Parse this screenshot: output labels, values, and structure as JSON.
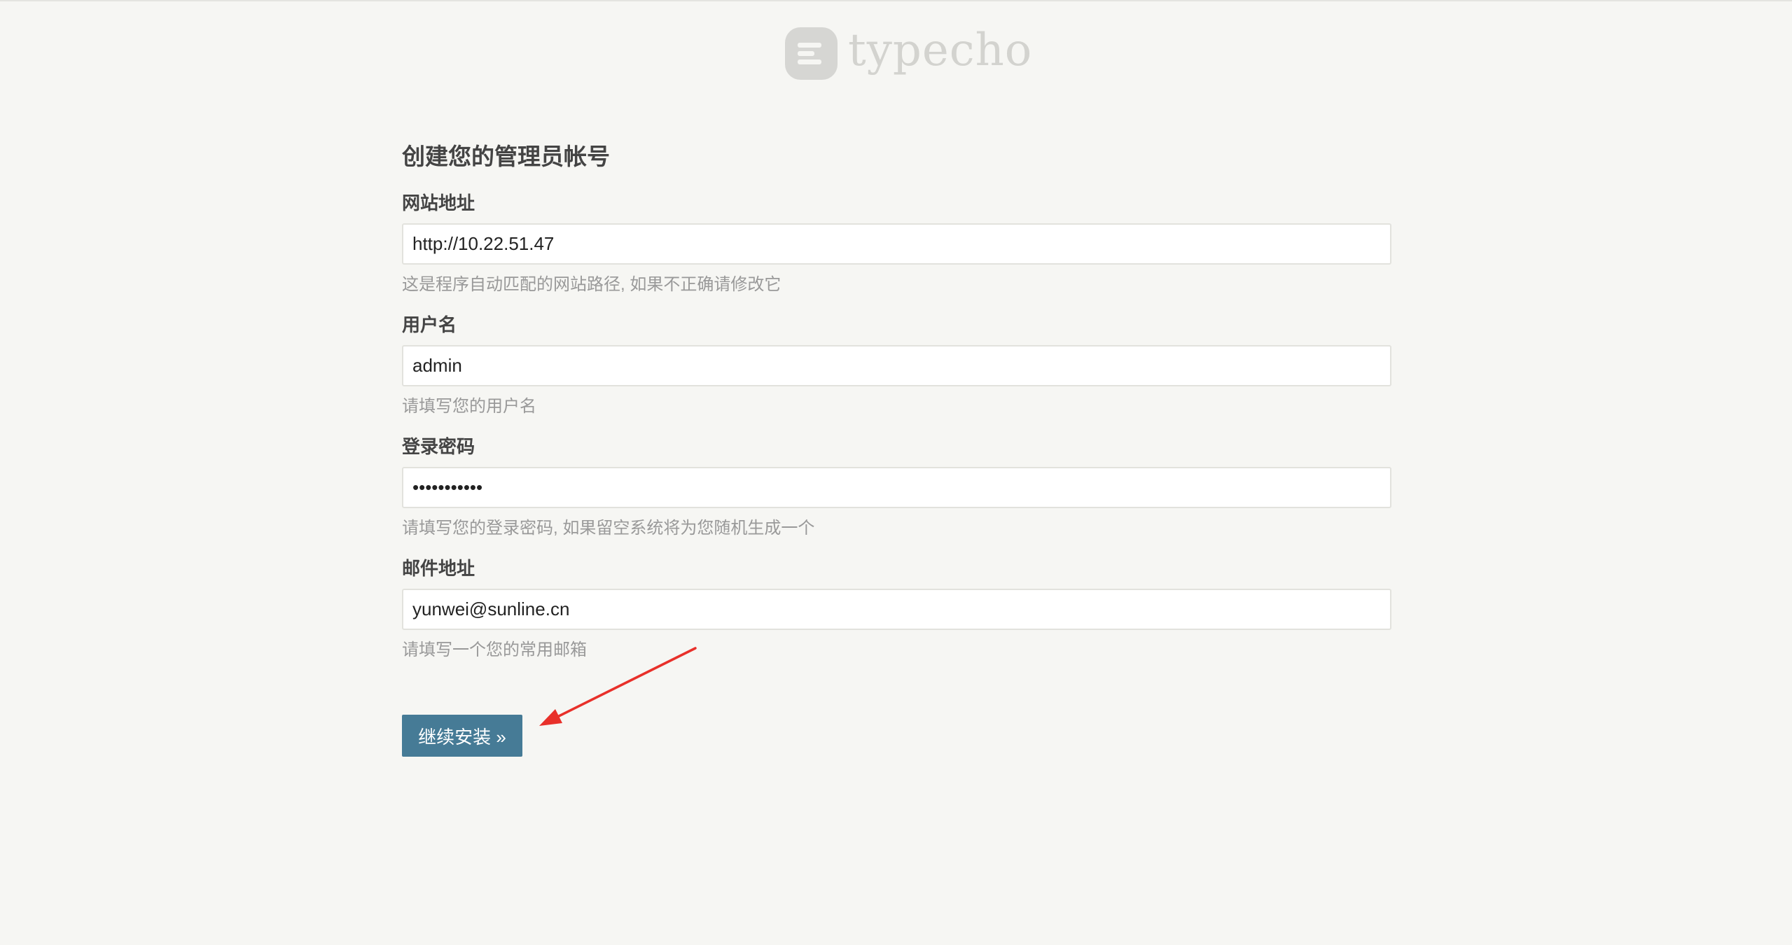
{
  "logo": {
    "text": "typecho",
    "icon": "typecho-logo-icon"
  },
  "heading": "创建您的管理员帐号",
  "fields": [
    {
      "label": "网站地址",
      "value": "http://10.22.51.47",
      "type": "text",
      "description": "这是程序自动匹配的网站路径, 如果不正确请修改它"
    },
    {
      "label": "用户名",
      "value": "admin",
      "type": "text",
      "description": "请填写您的用户名"
    },
    {
      "label": "登录密码",
      "value": "xxxxxxxxxxx",
      "type": "password",
      "description": "请填写您的登录密码, 如果留空系统将为您随机生成一个"
    },
    {
      "label": "邮件地址",
      "value": "yunwei@sunline.cn",
      "type": "text",
      "description": "请填写一个您的常用邮箱"
    }
  ],
  "submit_label": "继续安装 »",
  "annotation": {
    "icon": "red-arrow-annotation",
    "color": "#e8302a"
  },
  "colors": {
    "background": "#f6f6f3",
    "button": "#467b96",
    "logo": "#d3d3cf"
  }
}
